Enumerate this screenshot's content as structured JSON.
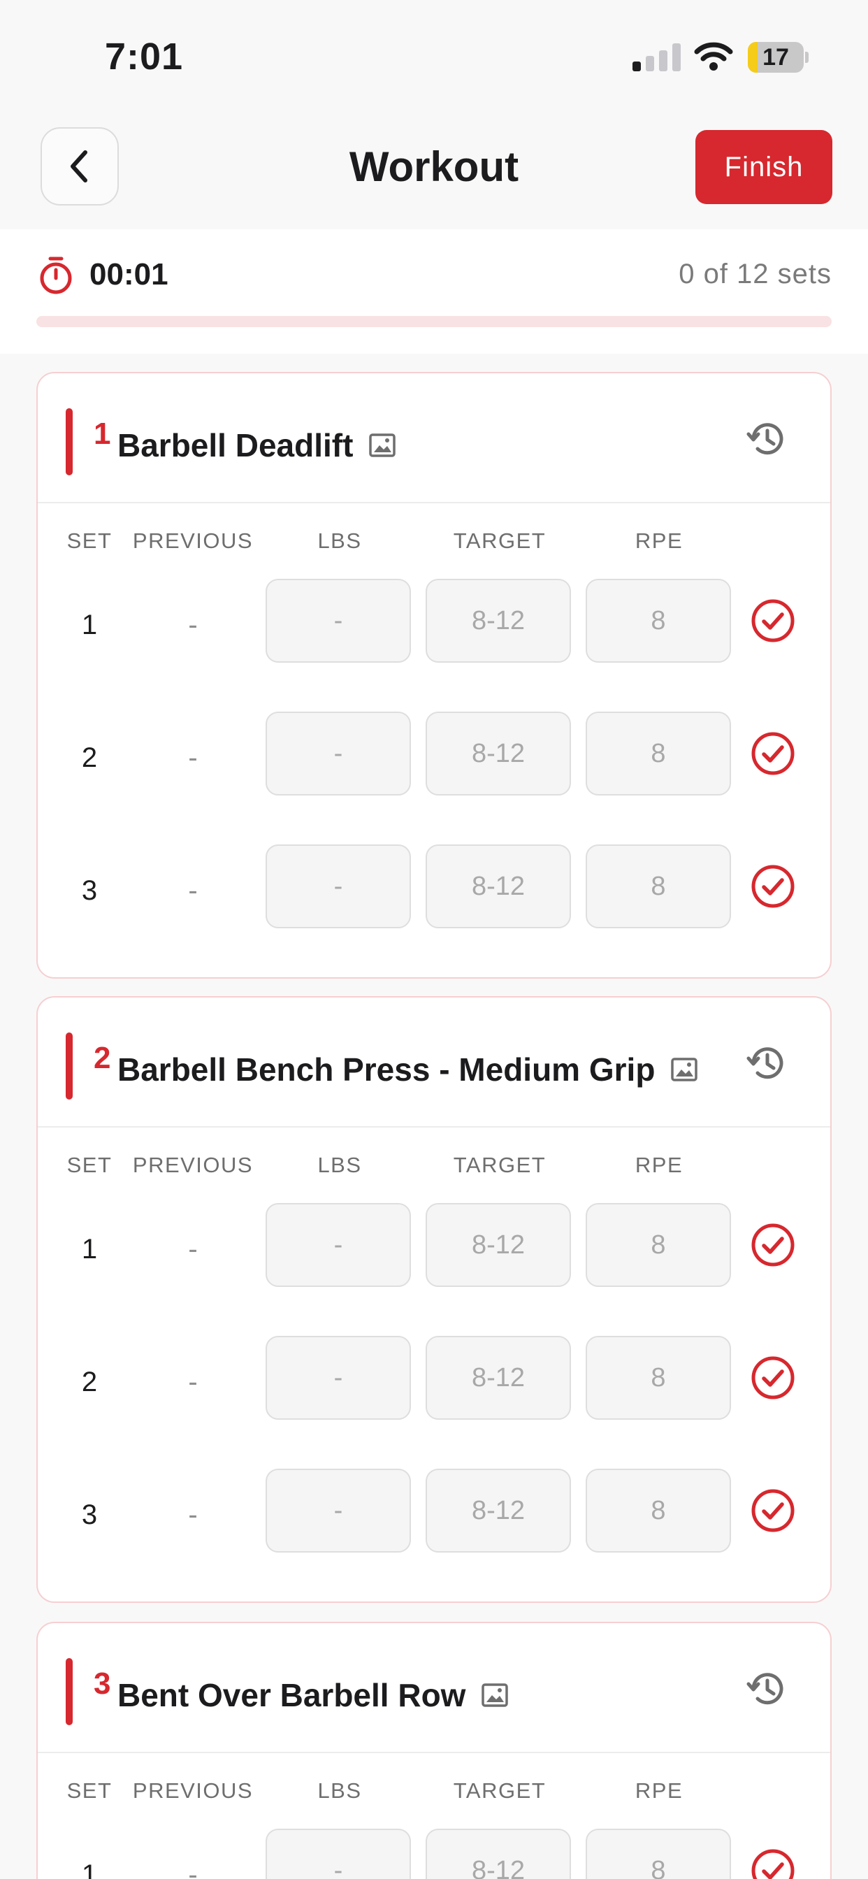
{
  "status_bar": {
    "time": "7:01",
    "battery": "17"
  },
  "header": {
    "title": "Workout",
    "finish_label": "Finish"
  },
  "timer": {
    "elapsed": "00:01",
    "sets_progress": "0 of 12 sets",
    "completed_fraction": 0
  },
  "columns": {
    "set": "SET",
    "previous": "PREVIOUS",
    "lbs": "LBS",
    "target": "TARGET",
    "rpe": "RPE"
  },
  "exercises": [
    {
      "number": "1",
      "name": "Barbell Deadlift",
      "sets": [
        {
          "set": "1",
          "previous": "-",
          "lbs": "-",
          "target": "8-12",
          "rpe": "8"
        },
        {
          "set": "2",
          "previous": "-",
          "lbs": "-",
          "target": "8-12",
          "rpe": "8"
        },
        {
          "set": "3",
          "previous": "-",
          "lbs": "-",
          "target": "8-12",
          "rpe": "8"
        }
      ]
    },
    {
      "number": "2",
      "name": "Barbell Bench Press - Medium Grip",
      "sets": [
        {
          "set": "1",
          "previous": "-",
          "lbs": "-",
          "target": "8-12",
          "rpe": "8"
        },
        {
          "set": "2",
          "previous": "-",
          "lbs": "-",
          "target": "8-12",
          "rpe": "8"
        },
        {
          "set": "3",
          "previous": "-",
          "lbs": "-",
          "target": "8-12",
          "rpe": "8"
        }
      ]
    },
    {
      "number": "3",
      "name": "Bent Over Barbell Row",
      "sets": [
        {
          "set": "1",
          "previous": "-",
          "lbs": "-",
          "target": "8-12",
          "rpe": "8"
        }
      ]
    }
  ],
  "colors": {
    "accent": "#d6282e",
    "card_border": "#f6cfd1",
    "progress_track": "#f9e2e3"
  }
}
